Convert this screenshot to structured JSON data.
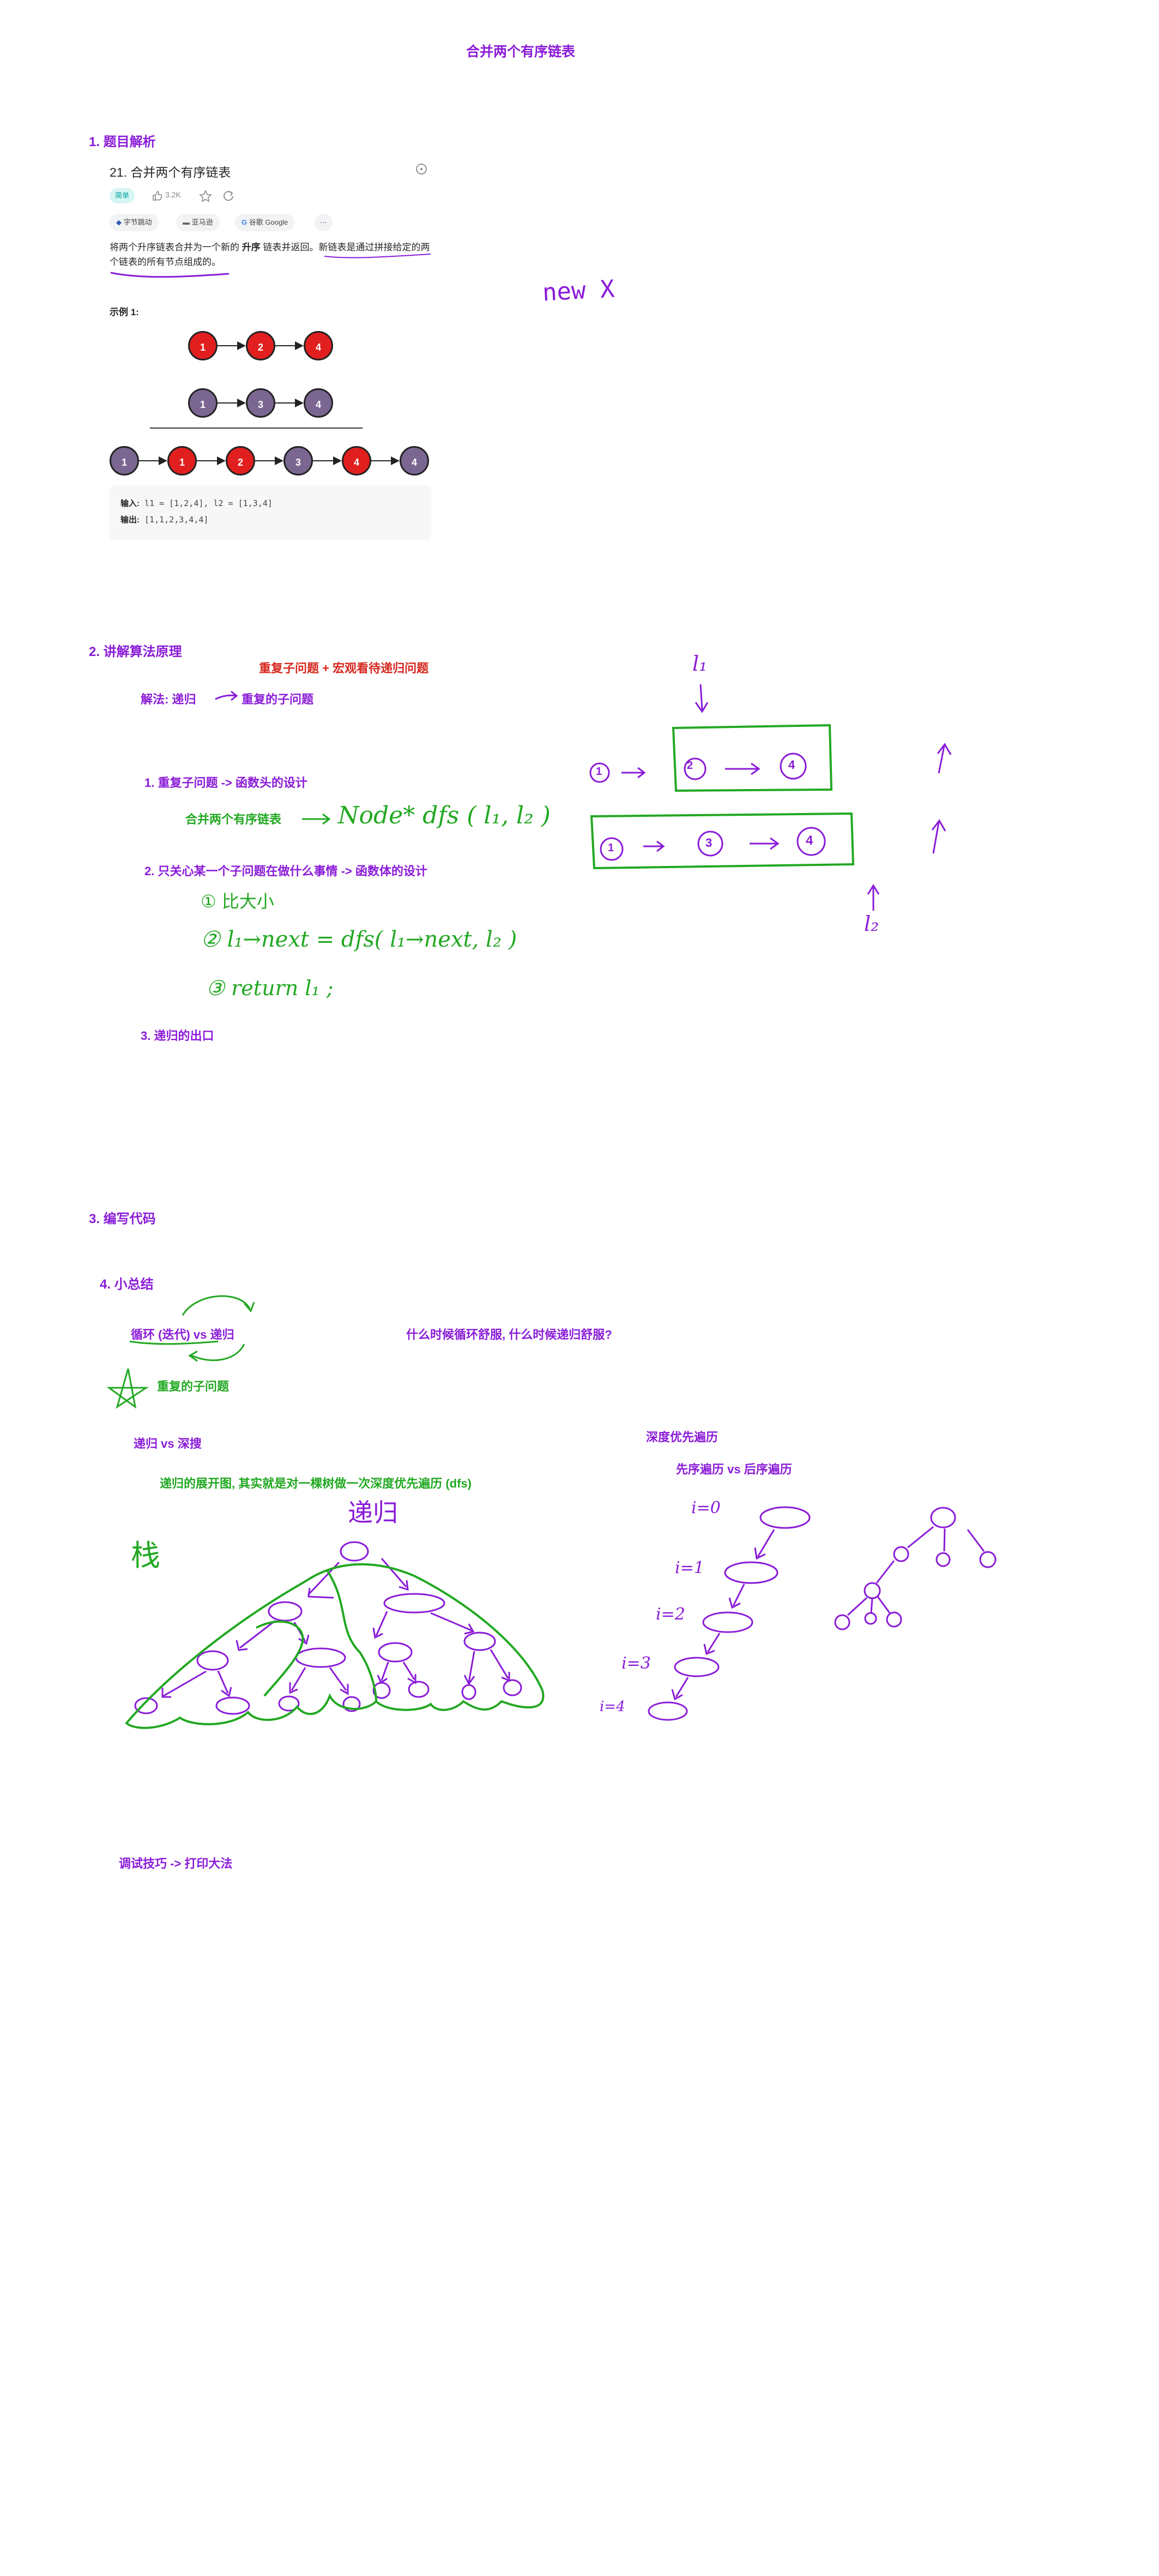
{
  "page_title": "合并两个有序链表",
  "section1": {
    "title": "1. 题目解析"
  },
  "problem": {
    "title": "21. 合并两个有序链表",
    "difficulty": "简单",
    "likes": "3.2K",
    "companies": [
      "字节跳动",
      "亚马逊",
      "谷歌 Google",
      "···"
    ],
    "desc_1": "将两个升序链表合并为一个新的 ",
    "desc_bold": "升序",
    "desc_2": " 链表并返回。新链表是通过拼接给定的两个链表的所有节点组成的。",
    "example_label": "示例 1:",
    "list1": [
      "1",
      "2",
      "4"
    ],
    "list2": [
      "1",
      "3",
      "4"
    ],
    "merged": [
      "1",
      "1",
      "2",
      "3",
      "4",
      "4"
    ],
    "input_label": "输入:",
    "input_value": "l1 = [1,2,4], l2 = [1,3,4]",
    "output_label": "输出:",
    "output_value": "[1,1,2,3,4,4]"
  },
  "handwriting": {
    "new_x": "new X",
    "l1": "l₁",
    "l2": "l₂",
    "dfs_sig": "Node* dfs ( l₁, l₂ )",
    "step1": "① 比大小",
    "step2": "② l₁→next = dfs( l₁→next, l₂ )",
    "step3": "③ return l₁ ;",
    "diag_top": [
      "1",
      "2",
      "4"
    ],
    "diag_bottom": [
      "1",
      "3",
      "4"
    ],
    "stack": "栈",
    "recursion_word": "递归",
    "depth_labels": [
      "i=0",
      "i=1",
      "i=2",
      "i=3",
      "i=4"
    ]
  },
  "section2": {
    "title": "2. 讲解算法原理",
    "red_note": "重复子问题 + 宏观看待递归问题",
    "solution_label": "解法: 递归",
    "solution_target": "重复的子问题",
    "point1": "1. 重复子问题 -> 函数头的设计",
    "merge_label": "合并两个有序链表",
    "point2": "2. 只关心某一个子问题在做什么事情 -> 函数体的设计",
    "point3": "3. 递归的出口"
  },
  "section3": {
    "title": "3. 编写代码"
  },
  "section4": {
    "title": "4. 小总结",
    "loop_vs": "循环 (迭代) vs 递归",
    "question": "什么时候循环舒服, 什么时候递归舒服?",
    "repeat_sub": "重复的子问题",
    "rec_vs_dfs": "递归 vs 深搜",
    "rec_tree": "递归的展开图, 其实就是对一棵树做一次深度优先遍历 (dfs)",
    "dfs_title": "深度优先遍历",
    "pre_post": "先序遍历 vs 后序遍历",
    "debug": "调试技巧 -> 打印大法"
  },
  "colors": {
    "purple": "#8a1bd8",
    "green": "#22a822",
    "red": "#d5261d",
    "node_red": "#e11f1f",
    "node_purple": "#7a6691"
  }
}
